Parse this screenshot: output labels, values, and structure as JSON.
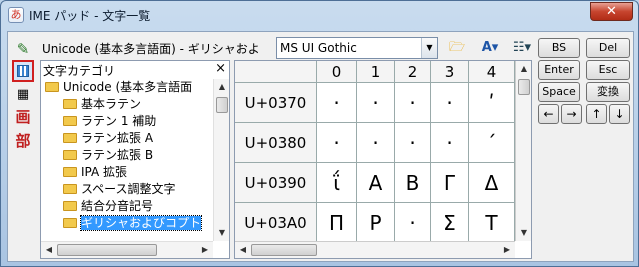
{
  "window": {
    "title": "IME パッド - 文字一覧",
    "close": "✕",
    "app_icon": "あ"
  },
  "strip": {
    "pencil": "✎",
    "keyboard": "▦",
    "kakusu": "画",
    "bushu": "部"
  },
  "toolbar": {
    "charset_title": "Unicode (基本多言語面) - ギリシャおよ",
    "font": "MS UI Gothic",
    "dropdown_arrow": "▼",
    "folder_icon": "🗁",
    "fontsize_icon": "A▾",
    "view_icon": "☷▾"
  },
  "category": {
    "header": "文字カテゴリ",
    "close": "×",
    "items": [
      {
        "label": "Unicode (基本多言語面",
        "level": "root"
      },
      {
        "label": "基本ラテン",
        "level": "child"
      },
      {
        "label": "ラテン 1 補助",
        "level": "child"
      },
      {
        "label": "ラテン拡張 A",
        "level": "child"
      },
      {
        "label": "ラテン拡張 B",
        "level": "child"
      },
      {
        "label": "IPA 拡張",
        "level": "child"
      },
      {
        "label": "スペース調整文字",
        "level": "child"
      },
      {
        "label": "結合分音記号",
        "level": "child"
      },
      {
        "label": "ギリシャおよびコプト",
        "level": "child",
        "selected": true
      }
    ]
  },
  "grid": {
    "columns": [
      "0",
      "1",
      "2",
      "3",
      "4"
    ],
    "rows": [
      {
        "label": "U+0370",
        "cells": [
          "·",
          "·",
          "·",
          "·",
          "ʹ"
        ]
      },
      {
        "label": "U+0380",
        "cells": [
          "·",
          "·",
          "·",
          "·",
          "΄"
        ]
      },
      {
        "label": "U+0390",
        "cells": [
          "ΐ",
          "Α",
          "Β",
          "Γ",
          "Δ"
        ]
      },
      {
        "label": "U+03A0",
        "cells": [
          "Π",
          "Ρ",
          "·",
          "Σ",
          "Τ"
        ]
      }
    ]
  },
  "scroll": {
    "up": "▲",
    "down": "▼",
    "left": "◀",
    "right": "▶"
  },
  "buttons": {
    "bs": "BS",
    "del": "Del",
    "enter": "Enter",
    "esc": "Esc",
    "space": "Space",
    "henkan": "変換",
    "left": "←",
    "right": "→",
    "up": "↑",
    "down": "↓"
  }
}
